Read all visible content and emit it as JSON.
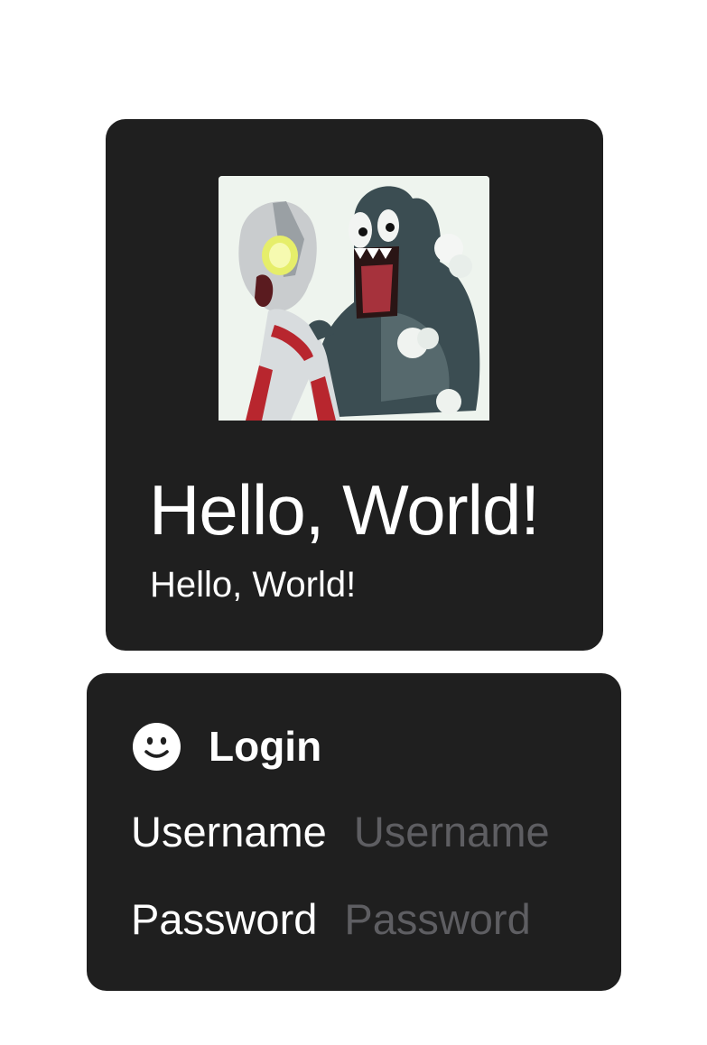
{
  "hello_card": {
    "image_alt": "cartoon of a monster biting a silver hero",
    "title": "Hello, World!",
    "subtitle": "Hello, World!"
  },
  "login_card": {
    "icon": "smiley-icon",
    "title": "Login",
    "username": {
      "label": "Username",
      "placeholder": "Username",
      "value": ""
    },
    "password": {
      "label": "Password",
      "placeholder": "Password",
      "value": ""
    }
  },
  "colors": {
    "card_background": "#1f1f1f",
    "text": "#ffffff",
    "placeholder": "#5e5e62",
    "page_background": "#ffffff"
  }
}
